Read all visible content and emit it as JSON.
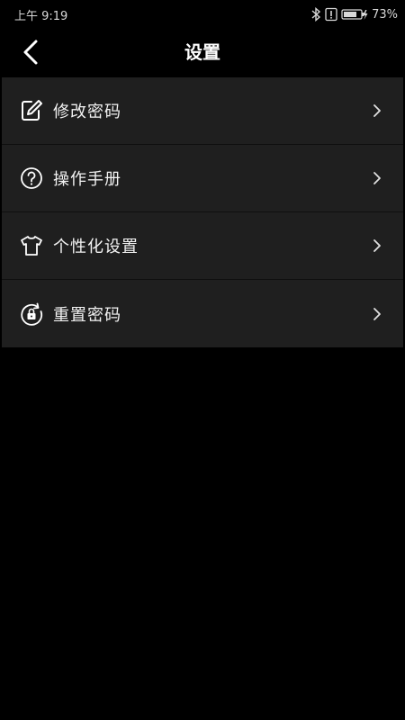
{
  "status_bar": {
    "time": "上午 9:19",
    "battery": "73%"
  },
  "header": {
    "title": "设置"
  },
  "menu": {
    "items": [
      {
        "label": "修改密码",
        "icon": "edit-icon"
      },
      {
        "label": "操作手册",
        "icon": "help-icon"
      },
      {
        "label": "个性化设置",
        "icon": "tshirt-icon"
      },
      {
        "label": "重置密码",
        "icon": "lock-reset-icon"
      }
    ]
  },
  "colors": {
    "background": "#000000",
    "menu_background": "#1f1f1f",
    "text": "#ffffff"
  }
}
